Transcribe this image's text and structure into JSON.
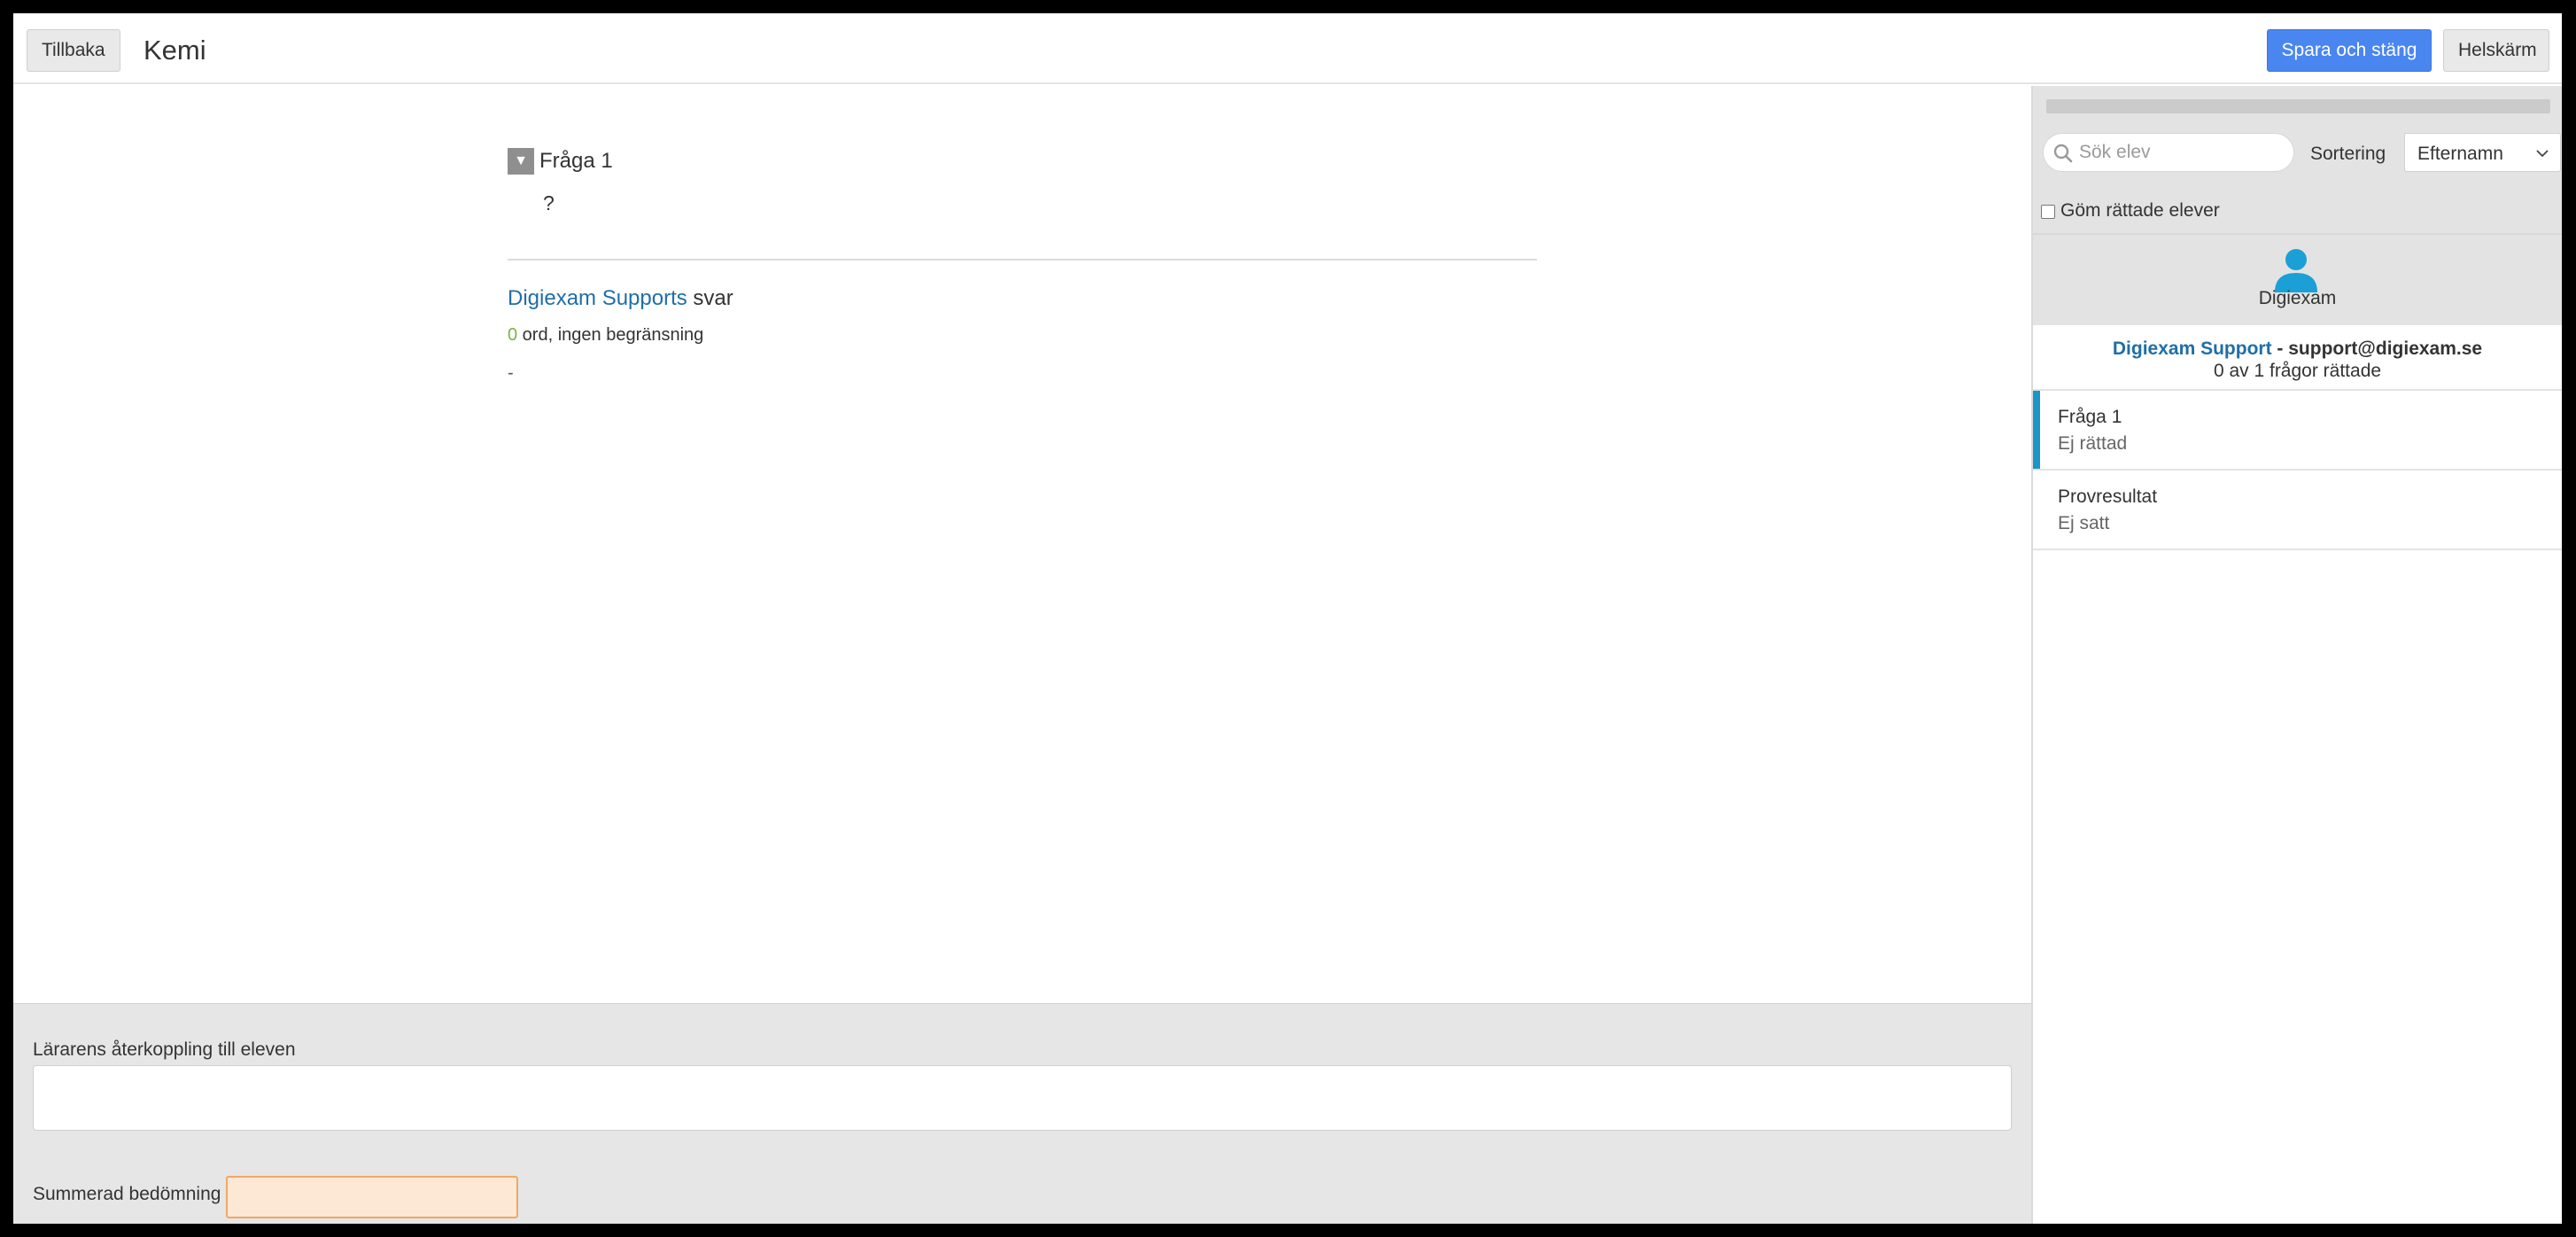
{
  "header": {
    "back_label": "Tillbaka",
    "title": "Kemi",
    "save_label": "Spara och stäng",
    "fullscreen_label": "Helskärm"
  },
  "main": {
    "question": {
      "toggle_icon": "▼",
      "title": "Fråga 1",
      "text": "?"
    },
    "answer": {
      "student_name": "Digiexam Supports",
      "suffix": " svar",
      "word_count": "0",
      "word_info": " ord, ingen begränsning",
      "content": "-"
    }
  },
  "footer": {
    "feedback_label": "Lärarens återkoppling till eleven",
    "feedback_value": "",
    "grade_label": "Summerad bedömning",
    "grade_value": ""
  },
  "sidebar": {
    "search_placeholder": "Sök elev",
    "sort_label": "Sortering",
    "sort_value": "Efternamn",
    "hide_label": "Göm rättade elever",
    "hide_checked": false,
    "avatar_name": "Digiexam",
    "student_name": "Digiexam Support",
    "student_email": " - support@digiexam.se",
    "student_progress": "0 av 1 frågor rättade",
    "items": [
      {
        "title": "Fråga 1",
        "status": "Ej rättad",
        "active": true
      },
      {
        "title": "Provresultat",
        "status": "Ej satt",
        "active": false
      }
    ]
  },
  "colors": {
    "primary": "#4a86f0",
    "link": "#1f6ea8",
    "active_bar": "#1c94c6",
    "avatar": "#1aa0d6",
    "count": "#7cb342"
  },
  "icons": {
    "toggle": "triangle-down-icon",
    "search": "search-icon",
    "sort": "chevron-down-icon",
    "avatar": "user-icon"
  }
}
